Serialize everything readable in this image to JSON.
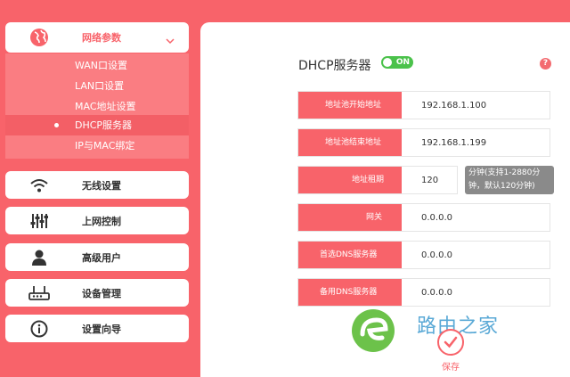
{
  "sidebar": {
    "network": {
      "label": "网络参数",
      "icon": "globe-icon"
    },
    "subitems": [
      {
        "label": "WAN口设置"
      },
      {
        "label": "LAN口设置"
      },
      {
        "label": "MAC地址设置"
      },
      {
        "label": "DHCP服务器"
      },
      {
        "label": "IP与MAC绑定"
      }
    ],
    "wireless": {
      "label": "无线设置",
      "icon": "wifi-icon"
    },
    "access": {
      "label": "上网控制",
      "icon": "sliders-icon"
    },
    "users": {
      "label": "高级用户",
      "icon": "user-icon"
    },
    "device": {
      "label": "设备管理",
      "icon": "router-icon"
    },
    "wizard": {
      "label": "设置向导",
      "icon": "info-icon"
    }
  },
  "main": {
    "title": "DHCP服务器",
    "toggle": "ON",
    "help": "?",
    "fields": {
      "start": {
        "label": "地址池开始地址",
        "value": "192.168.1.100"
      },
      "end": {
        "label": "地址池结束地址",
        "value": "192.168.1.199"
      },
      "lease": {
        "label": "地址租期",
        "value": "120",
        "hint": "分钟(支持1-2880分钟，默认120分钟)"
      },
      "gateway": {
        "label": "网关",
        "value": "0.0.0.0"
      },
      "dns1": {
        "label": "首选DNS服务器",
        "value": "0.0.0.0"
      },
      "dns2": {
        "label": "备用DNS服务器",
        "value": "0.0.0.0"
      }
    },
    "save": "保存"
  },
  "watermark": {
    "text": "路由之家"
  },
  "colors": {
    "accent": "#f8636a",
    "toggle_on": "#4bc24b"
  }
}
